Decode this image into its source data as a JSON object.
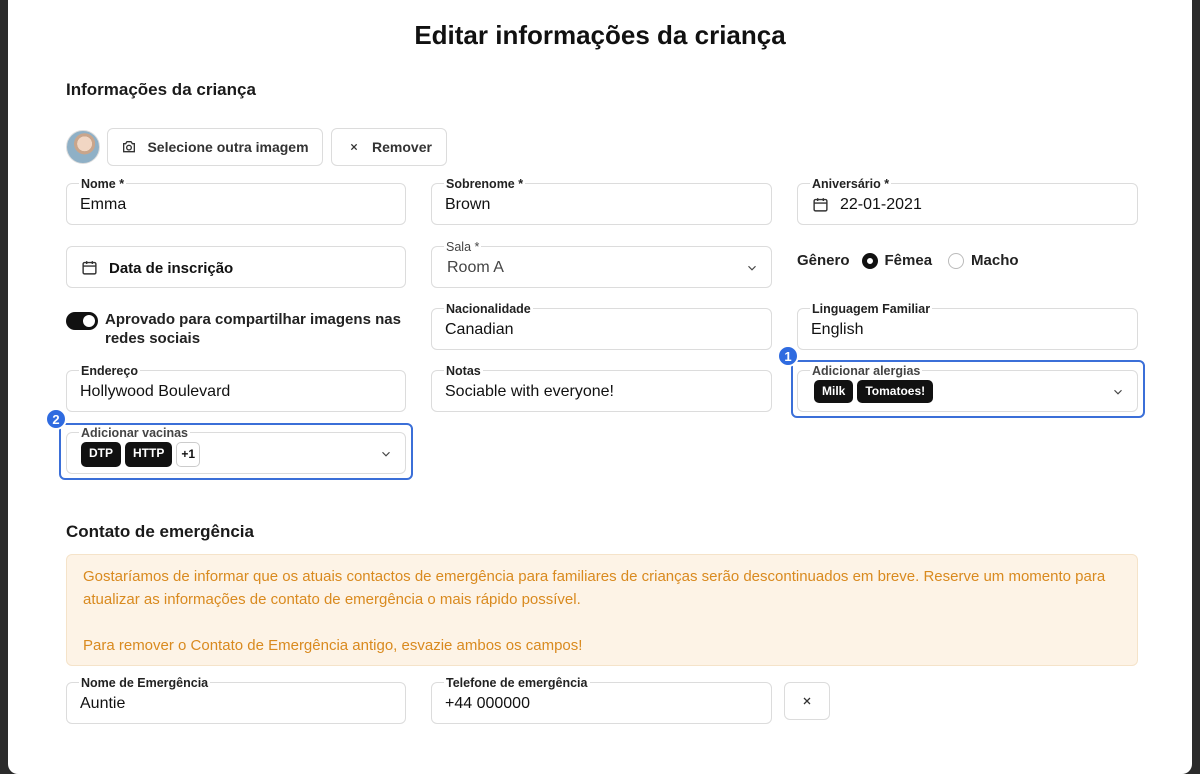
{
  "dialog": {
    "title": "Editar informações da criança"
  },
  "child_section": {
    "title": "Informações da criança",
    "select_image_label": "Selecione outra imagem",
    "remove_label": "Remover"
  },
  "fields": {
    "first_name": {
      "label": "Nome *",
      "value": "Emma"
    },
    "last_name": {
      "label": "Sobrenome *",
      "value": "Brown"
    },
    "birthday": {
      "label": "Aniversário *",
      "value": "22-01-2021"
    },
    "enrollment_date": {
      "placeholder": "Data de inscrição"
    },
    "room": {
      "label": "Sala *",
      "value": "Room A"
    },
    "gender": {
      "label": "Gênero",
      "options": [
        "Fêmea",
        "Macho"
      ],
      "selected": "Fêmea"
    },
    "social_toggle": {
      "label": "Aprovado para compartilhar imagens nas redes sociais",
      "checked": true
    },
    "nationality": {
      "label": "Nacionalidade",
      "value": "Canadian"
    },
    "home_language": {
      "label": "Linguagem Familiar",
      "value": "English"
    },
    "address": {
      "label": "Endereço",
      "value": "Hollywood Boulevard"
    },
    "notes": {
      "label": "Notas",
      "value": "Sociable with everyone!"
    },
    "allergies": {
      "label": "Adicionar alergias",
      "chips": [
        "Milk",
        "Tomatoes!"
      ]
    },
    "vaccines": {
      "label": "Adicionar vacinas",
      "chips": [
        "DTP",
        "HTTP"
      ],
      "more": "+1"
    }
  },
  "annotations": {
    "badge_1": "1",
    "badge_2": "2"
  },
  "emergency_section": {
    "title": "Contato de emergência",
    "alert_line1": "Gostaríamos de informar que os atuais contactos de emergência para familiares de crianças serão descontinuados em breve. Reserve um momento para atualizar as informações de contato de emergência o mais rápido possível.",
    "alert_line2": "Para remover o Contato de Emergência antigo, esvazie ambos os campos!",
    "name": {
      "label": "Nome de Emergência",
      "value": "Auntie"
    },
    "phone": {
      "label": "Telefone de emergência",
      "value": "+44 000000"
    }
  },
  "colors": {
    "accent": "#3b6fd8",
    "alert_text": "#d98a1f",
    "alert_bg": "#fdf3e6"
  },
  "icons": [
    "camera-icon",
    "close-icon",
    "calendar-icon",
    "chevron-down-icon"
  ]
}
